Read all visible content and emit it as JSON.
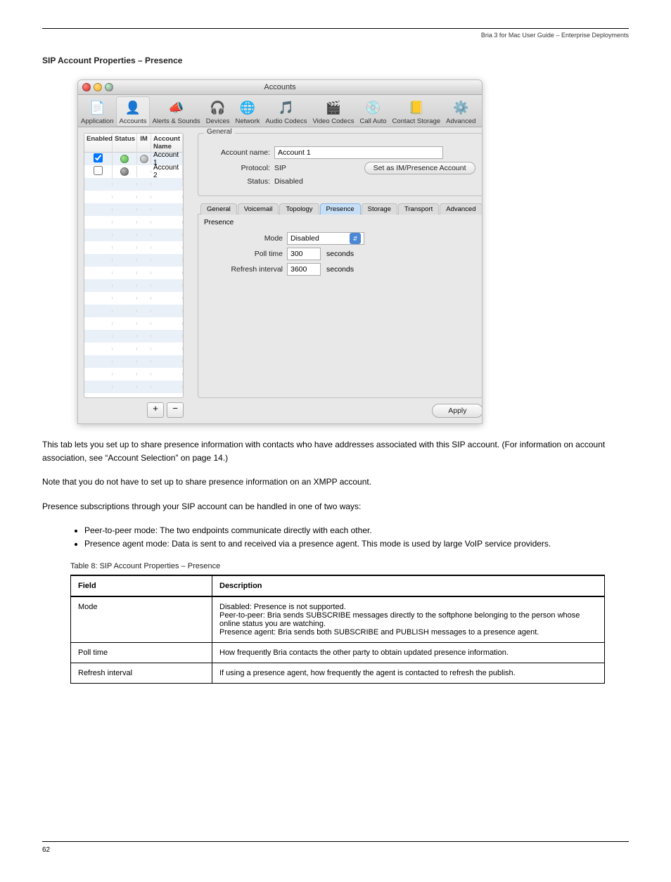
{
  "header_right": "Bria 3 for Mac User Guide – Enterprise Deployments",
  "window_title": "Accounts",
  "toolbar": [
    {
      "label": "Application",
      "glyph": "📄"
    },
    {
      "label": "Accounts",
      "glyph": "👤",
      "active": true
    },
    {
      "label": "Alerts & Sounds",
      "glyph": "📣"
    },
    {
      "label": "Devices",
      "glyph": "🎧"
    },
    {
      "label": "Network",
      "glyph": "🌐"
    },
    {
      "label": "Audio Codecs",
      "glyph": "🎵"
    },
    {
      "label": "Video Codecs",
      "glyph": "🎬"
    },
    {
      "label": "Call Auto",
      "glyph": "💿"
    },
    {
      "label": "Contact Storage",
      "glyph": "📒"
    },
    {
      "label": "Advanced",
      "glyph": "⚙️"
    }
  ],
  "acct_headers": {
    "en": "Enabled",
    "st": "Status",
    "im": "IM",
    "an": "Account Name"
  },
  "accounts": [
    {
      "enabled": true,
      "status": "green",
      "im": "gray",
      "name": "Account 1"
    },
    {
      "enabled": false,
      "status": "gray-dark",
      "im": "",
      "name": "Account 2"
    }
  ],
  "left_buttons": {
    "add": "+",
    "remove": "−"
  },
  "general_group": {
    "title": "General",
    "account_name_label": "Account name:",
    "account_name_value": "Account 1",
    "protocol_label": "Protocol:",
    "protocol_value": "SIP",
    "status_label": "Status:",
    "status_value": "Disabled",
    "set_btn": "Set as IM/Presence Account"
  },
  "subtabs": [
    "General",
    "Voicemail",
    "Topology",
    "Presence",
    "Storage",
    "Transport",
    "Advanced"
  ],
  "subtab_active_index": 3,
  "presence": {
    "group_title": "Presence",
    "mode_label": "Mode",
    "mode_value": "Disabled",
    "poll_label": "Poll time",
    "poll_value": "300",
    "poll_unit": "seconds",
    "refresh_label": "Refresh interval",
    "refresh_value": "3600",
    "refresh_unit": "seconds"
  },
  "apply_label": "Apply",
  "section_heading": "SIP Account Properties – Presence",
  "body_p1": "This tab lets you set up to share presence information with contacts who have addresses associated with this SIP account. ",
  "body_p1_b": "(For information on account association, see “Account Selection” on page 14.)",
  "body_p2": "Note that you do not have to set up to share presence information on an XMPP account.",
  "body_p3": "Presence subscriptions through your SIP account can be handled in one of two ways:",
  "body_ul_1": "Peer-to-peer mode: The two endpoints communicate directly with each other.",
  "body_ul_2": "Presence agent mode: Data is sent to and received via a presence agent. This mode is used by large VoIP service providers.",
  "table_caption": "Table 8: SIP Account Properties – Presence",
  "tbl_h1": "Field",
  "tbl_h2": "Description",
  "tbl_r1_c1": "Mode",
  "tbl_r1_c2": "Disabled: Presence is not supported.\nPeer-to-peer: Bria sends SUBSCRIBE messages directly to the softphone belonging to the person whose online status you are watching.\nPresence agent: Bria sends both SUBSCRIBE and PUBLISH messages to a presence agent.",
  "tbl_r2_c1": "Poll time",
  "tbl_r2_c2": "How frequently Bria contacts the other party to obtain updated presence information.",
  "tbl_r3_c1": "Refresh interval",
  "tbl_r3_c2": "If using a presence agent, how frequently the agent is contacted to refresh the publish.",
  "page_num": "62"
}
